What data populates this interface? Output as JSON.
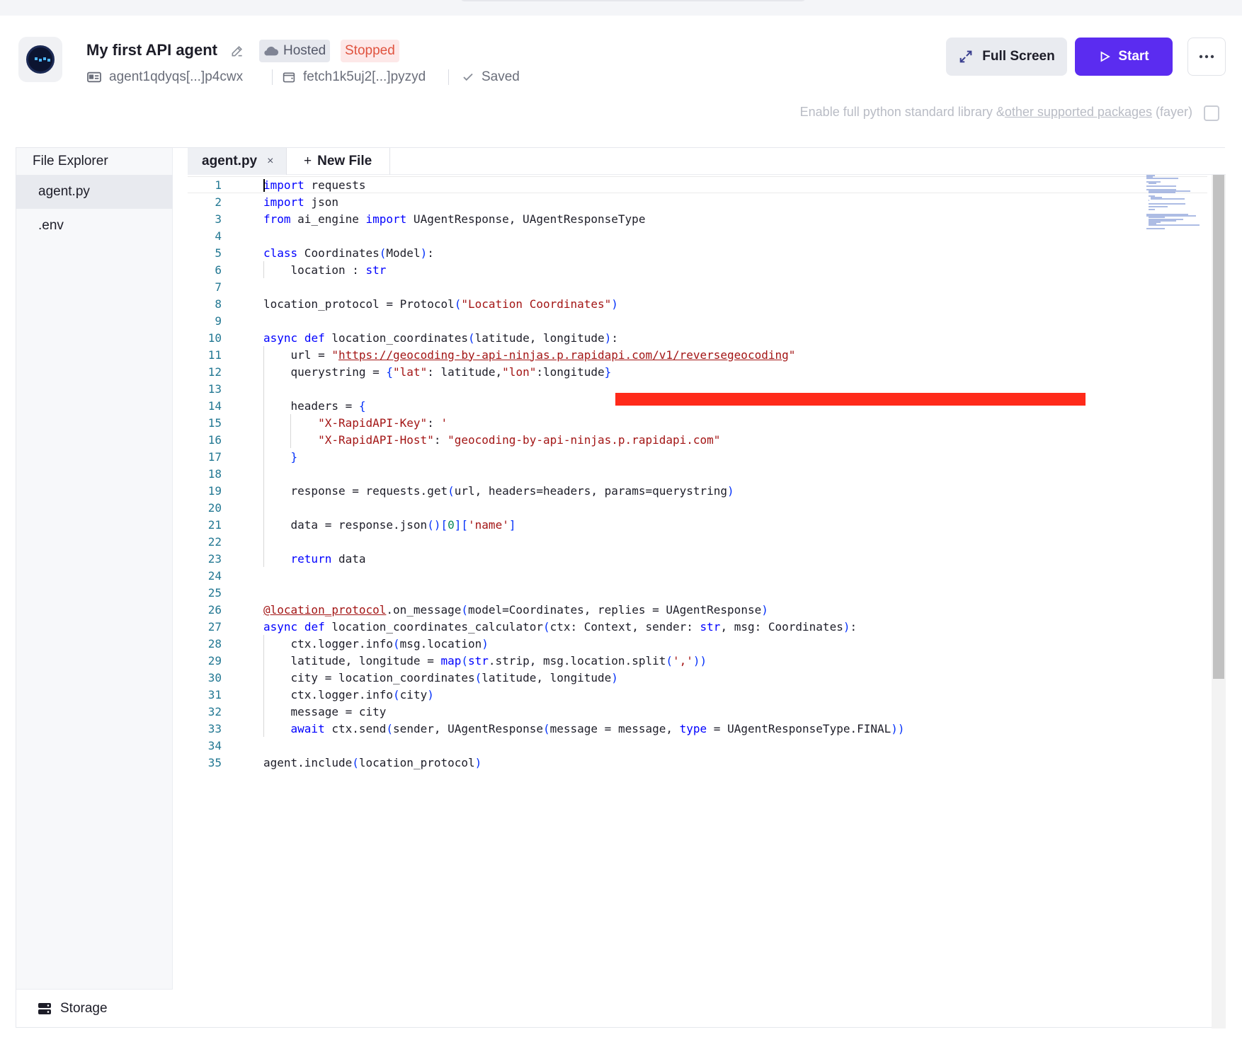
{
  "header": {
    "title": "My first API agent",
    "hosted_label": "Hosted",
    "status_label": "Stopped",
    "agent_address": "agent1qdyqs[...]p4cwx",
    "wallet_address": "fetch1k5uj2[...]pyzyd",
    "save_state": "Saved",
    "fullscreen_label": "Full Screen",
    "start_label": "Start",
    "stdlib_text_pre": "Enable full python standard library &",
    "stdlib_link": "other supported packages",
    "stdlib_text_post": " (fayer)"
  },
  "sidebar": {
    "title": "File Explorer",
    "files": [
      "agent.py",
      ".env"
    ],
    "storage_label": "Storage"
  },
  "tabs": {
    "active": "agent.py",
    "close": "×",
    "new_file": "New File",
    "plus": "+"
  },
  "code": {
    "line_numbers": [
      "1",
      "2",
      "3",
      "4",
      "5",
      "6",
      "7",
      "8",
      "9",
      "10",
      "11",
      "12",
      "13",
      "14",
      "15",
      "16",
      "17",
      "18",
      "19",
      "20",
      "21",
      "22",
      "23",
      "24",
      "25",
      "26",
      "27",
      "28",
      "29",
      "30",
      "31",
      "32",
      "33",
      "34",
      "35"
    ],
    "lines": [
      "import requests",
      "import json",
      "from ai_engine import UAgentResponse, UAgentResponseType",
      "",
      "class Coordinates(Model):",
      "    location : str",
      "",
      "location_protocol = Protocol(\"Location Coordinates\")",
      "",
      "async def location_coordinates(latitude, longitude):",
      "    url = \"https://geocoding-by-api-ninjas.p.rapidapi.com/v1/reversegeocoding\"",
      "    querystring = {\"lat\": latitude,\"lon\":longitude}",
      "",
      "    headers = {",
      "        \"X-RapidAPI-Key\": '",
      "        \"X-RapidAPI-Host\": \"geocoding-by-api-ninjas.p.rapidapi.com\"",
      "    }",
      "",
      "    response = requests.get(url, headers=headers, params=querystring)",
      "",
      "    data = response.json()[0]['name']",
      "",
      "    return data",
      "",
      "",
      "@location_protocol.on_message(model=Coordinates, replies = UAgentResponse)",
      "async def location_coordinates_calculator(ctx: Context, sender: str, msg: Coordinates):",
      "    ctx.logger.info(msg.location)",
      "    latitude, longitude = map(str.strip, msg.location.split(','))",
      "    city = location_coordinates(latitude, longitude)",
      "    ctx.logger.info(city)",
      "    message = city",
      "    await ctx.send(sender, UAgentResponse(message = message, type = UAgentResponseType.FINAL))",
      "",
      "agent.include(location_protocol)"
    ]
  },
  "colors": {
    "accent": "#5b2cf0",
    "stopped": "#e0533f",
    "keyword": "#0000ff",
    "string": "#a31515",
    "redaction": "#ff2a1a"
  },
  "icons": [
    "agent-avatar-icon",
    "edit-icon",
    "cloud-icon",
    "id-card-icon",
    "wallet-icon",
    "check-icon",
    "expand-icon",
    "play-icon",
    "more-icon",
    "storage-icon"
  ]
}
